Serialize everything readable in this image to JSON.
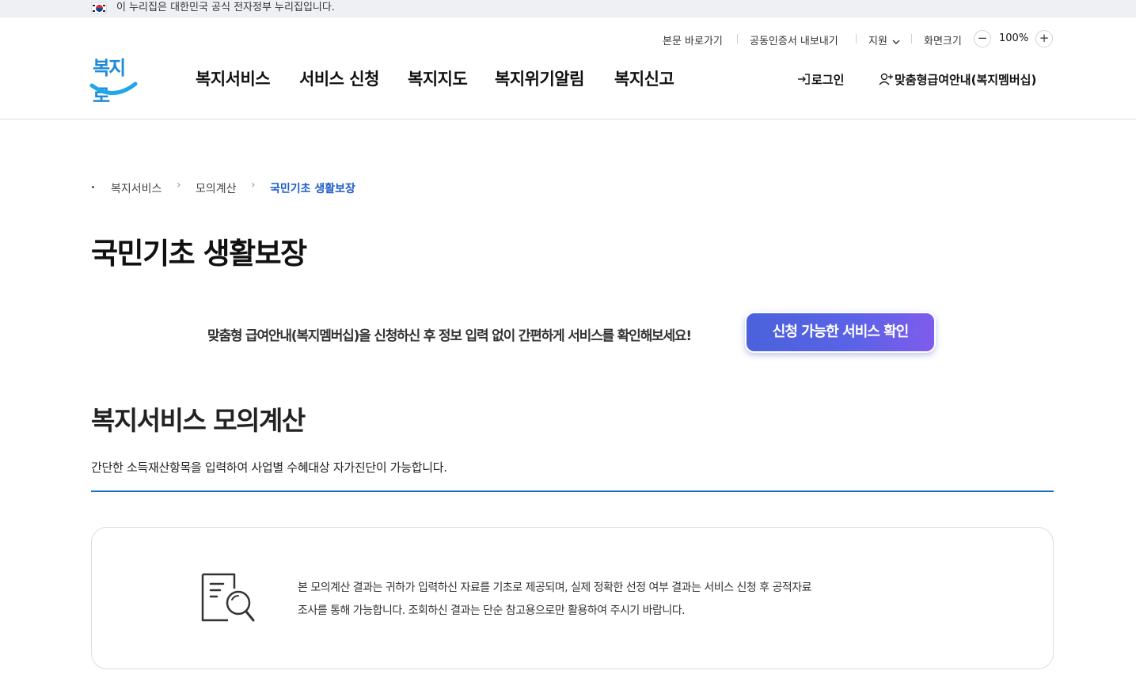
{
  "gov_banner": {
    "text": "이 누리집은 대한민국 공식 전자정부 누리집입니다."
  },
  "utility": {
    "skip_to_content": "본문 바로가기",
    "cert_export": "공동인증서 내보내기",
    "support": "지원",
    "screen_size": "화면크기",
    "zoom_out": "−",
    "zoom_level": "100%",
    "zoom_in": "+"
  },
  "logo": {
    "text": "복지로"
  },
  "gnb": {
    "items": [
      "복지서비스",
      "서비스 신청",
      "복지지도",
      "복지위기알림",
      "복지신고"
    ],
    "login": "로그인",
    "membership": "맞춤형급여안내(복지멤버십)"
  },
  "breadcrumb": [
    "복지서비스",
    "모의계산",
    "국민기초 생활보장"
  ],
  "page_title": "국민기초 생활보장",
  "promo": {
    "text": "맞춤형 급여안내(복지멤버십)을 신청하신 후 정보 입력 없이 간편하게 서비스를 확인해보세요!",
    "button": "신청 가능한 서비스 확인"
  },
  "section": {
    "title": "복지서비스 모의계산",
    "description": "간단한 소득재산항목을 입력하여 사업별 수혜대상 자가진단이 가능합니다."
  },
  "notice": {
    "line1": "본 모의계산 결과는 귀하가 입력하신 자료를 기초로 제공되며, 실제 정확한 선정 여부 결과는 서비스 신청 후 공적자료",
    "line2": "조사를 통해 가능합니다. 조회하신 결과는 단순 참고용으로만 활용하여 주시기 바랍니다.",
    "icon": "document-search-icon"
  },
  "colors": {
    "accent": "#1e5bcc",
    "section_line": "#1a6fc2",
    "button_gradient_start": "#4a62dc",
    "button_gradient_end": "#7f5cec",
    "logo": "#1f8bd8"
  }
}
